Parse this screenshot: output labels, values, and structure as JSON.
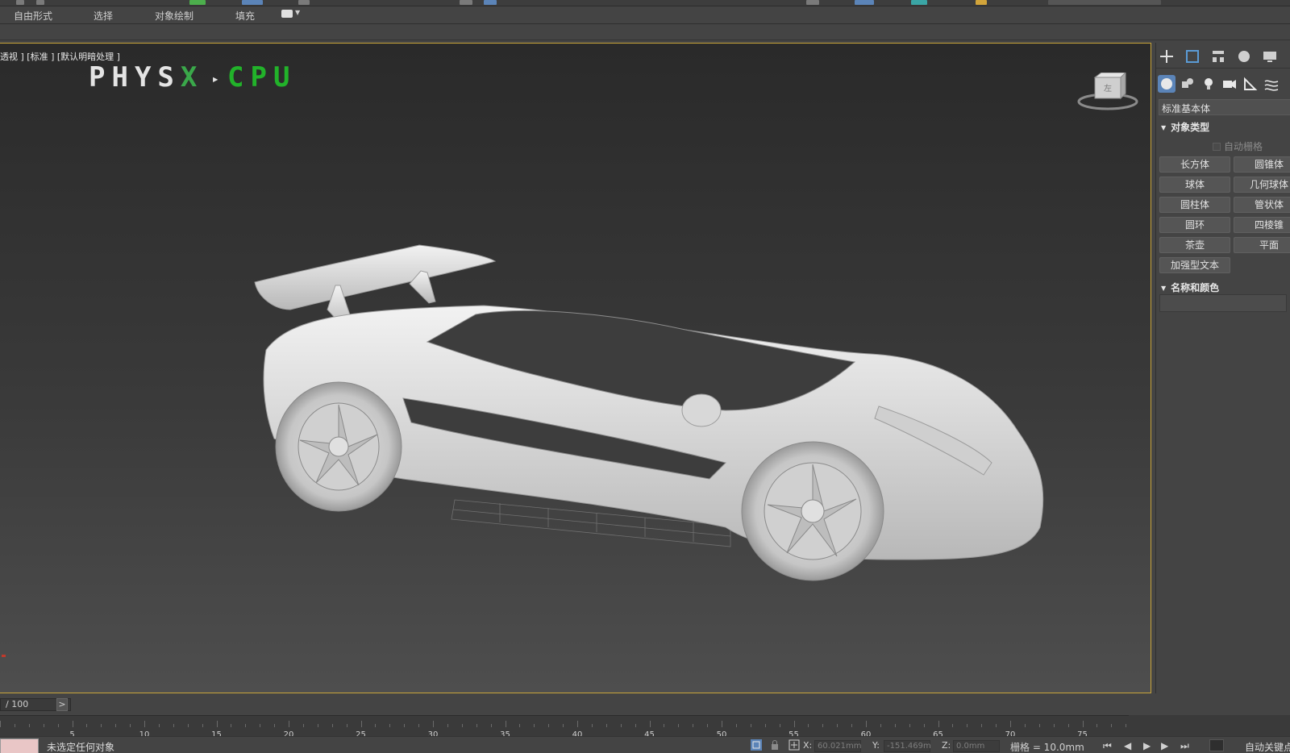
{
  "ribbon": {
    "tabs": [
      "自由形式",
      "选择",
      "对象绘制",
      "填充"
    ]
  },
  "viewport": {
    "label": "透视 ] [标准 ] [默认明暗处理 ]",
    "physx_word": "PHYS",
    "physx_x": "X",
    "physx_arrow": "▸",
    "physx_cpu": "CPU",
    "viewcube_label": "左"
  },
  "command_panel": {
    "dropdown_value": "标准基本体",
    "object_type_title": "对象类型",
    "autogrid_label": "自动栅格",
    "buttons": [
      "长方体",
      "圆锥体",
      "球体",
      "几何球体",
      "圆柱体",
      "管状体",
      "圆环",
      "四棱锥",
      "茶壶",
      "平面",
      "加强型文本"
    ],
    "name_color_title": "名称和颜色"
  },
  "time_slider": {
    "value": "/ 100",
    "next": ">"
  },
  "timeline": {
    "ticks": [
      "5",
      "10",
      "15",
      "20",
      "25",
      "30",
      "35",
      "40",
      "45",
      "50",
      "55",
      "60",
      "65",
      "70",
      "75"
    ]
  },
  "status_bar": {
    "message": "未选定任何对象",
    "x_label": "X:",
    "x_value": "60.021mm",
    "y_label": "Y:",
    "y_value": "-151.469m",
    "z_label": "Z:",
    "z_value": "0.0mm",
    "grid_label": "栅格 = 10.0mm",
    "auto_key": "自动关键点"
  },
  "colors": {
    "viewport_border": "#c9a53a",
    "physx_green": "#22b22a",
    "active_category": "#5b84b8"
  }
}
